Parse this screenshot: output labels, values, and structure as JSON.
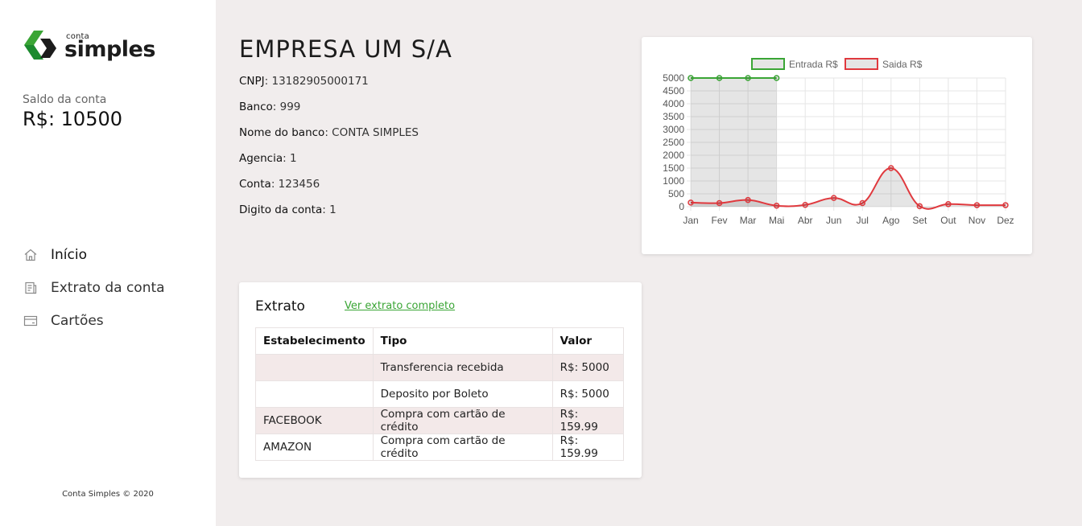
{
  "sidebar": {
    "logo": {
      "small": "conta",
      "big": "simples"
    },
    "balance_label": "Saldo da conta",
    "balance_value": "R$: 10500",
    "nav": [
      {
        "label": "Início",
        "icon": "home-icon",
        "active": true
      },
      {
        "label": "Extrato da conta",
        "icon": "receipt-icon",
        "active": false
      },
      {
        "label": "Cartões",
        "icon": "card-icon",
        "active": false
      }
    ],
    "footer": "Conta Simples © 2020"
  },
  "company": {
    "name": "EMPRESA UM S/A",
    "fields": [
      {
        "label": "CNPJ",
        "value": "13182905000171"
      },
      {
        "label": "Banco",
        "value": "999"
      },
      {
        "label": "Nome do banco",
        "value": "CONTA SIMPLES"
      },
      {
        "label": "Agencia",
        "value": "1"
      },
      {
        "label": "Conta",
        "value": "123456"
      },
      {
        "label": "Digito da conta",
        "value": "1"
      }
    ]
  },
  "extrato": {
    "title": "Extrato",
    "link": "Ver extrato completo",
    "columns": [
      "Estabelecimento",
      "Tipo",
      "Valor"
    ],
    "rows": [
      [
        "",
        "Transferencia recebida",
        "R$: 5000"
      ],
      [
        "",
        "Deposito por Boleto",
        "R$: 5000"
      ],
      [
        "FACEBOOK",
        "Compra com cartão de crédito",
        "R$: 159.99"
      ],
      [
        "AMAZON",
        "Compra com cartão de crédito",
        "R$: 159.99"
      ]
    ]
  },
  "colors": {
    "accent_green": "#3aa535",
    "entrada": "#3aa535",
    "saida": "#e0393e"
  },
  "chart_data": {
    "type": "line",
    "categories": [
      "Jan",
      "Fev",
      "Mar",
      "Mai",
      "Abr",
      "Jun",
      "Jul",
      "Ago",
      "Set",
      "Out",
      "Nov",
      "Dez"
    ],
    "series": [
      {
        "name": "Entrada R$",
        "values": [
          5000,
          5000,
          5000,
          5000,
          null,
          null,
          null,
          null,
          null,
          null,
          null,
          null
        ],
        "color": "#3aa535"
      },
      {
        "name": "Saida R$",
        "values": [
          160,
          140,
          260,
          40,
          70,
          340,
          140,
          1500,
          20,
          100,
          60,
          60
        ],
        "color": "#e0393e"
      }
    ],
    "yticks": [
      0,
      500,
      1000,
      1500,
      2000,
      2500,
      3000,
      3500,
      4000,
      4500,
      5000
    ],
    "ylim": [
      0,
      5000
    ],
    "grid": true,
    "legend": "top"
  }
}
